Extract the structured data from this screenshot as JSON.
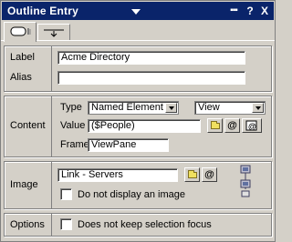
{
  "window": {
    "title": "Outline Entry",
    "help_label": "?",
    "close_label": "X"
  },
  "tabs": [
    {
      "icon": "basics-tab-icon"
    },
    {
      "icon": "advanced-tab-icon"
    }
  ],
  "basics": {
    "label_caption": "Label",
    "label_value": "Acme Directory",
    "alias_caption": "Alias",
    "alias_value": ""
  },
  "content": {
    "section_caption": "Content",
    "type_caption": "Type",
    "type_value": "Named Element",
    "subtype_value": "View",
    "value_caption": "Value",
    "value_value": "($People)",
    "frame_caption": "Frame",
    "frame_value": "ViewPane"
  },
  "image": {
    "section_caption": "Image",
    "image_value": "Link - Servers",
    "no_image_caption": "Do not display an image",
    "no_image_checked": false
  },
  "options": {
    "section_caption": "Options",
    "focus_caption": "Does not keep selection focus",
    "focus_checked": false
  },
  "icons": {
    "folder": "folder-icon",
    "at": "at-icon",
    "formula": "formula-icon",
    "image_preview": "server-image-icon"
  },
  "colors": {
    "titlebar": "#0a246a",
    "face": "#d4d0c8"
  }
}
